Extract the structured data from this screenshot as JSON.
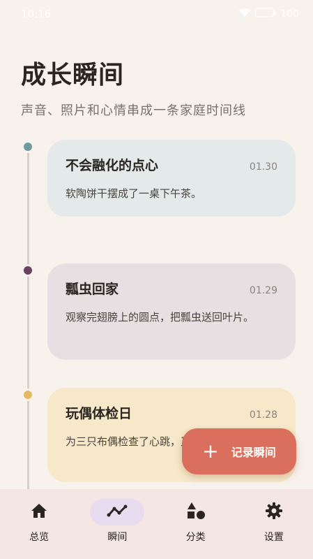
{
  "status_bar": {
    "time": "10:16",
    "battery": "100"
  },
  "header": {
    "title": "成长瞬间",
    "subtitle": "声音、照片和心情串成一条家庭时间线"
  },
  "moments": [
    {
      "title": "不会融化的点心",
      "date": "01.30",
      "text": "软陶饼干摆成了一桌下午茶。",
      "dot_color": "#6e9aa0",
      "card_color": "#e3eae9"
    },
    {
      "title": "瓢虫回家",
      "date": "01.29",
      "text": "观察完翅膀上的圆点，把瓢虫送回叶片。",
      "dot_color": "#6b4160",
      "card_color": "#e7dfe2"
    },
    {
      "title": "玩偶体检日",
      "date": "01.28",
      "text": "为三只布偶检查了心跳，又给小熊点睡。",
      "dot_color": "#e4b867",
      "card_color": "#f6e8c8"
    }
  ],
  "fab": {
    "icon": "plus-icon",
    "label": "记录瞬间",
    "color": "#d96f5c"
  },
  "nav": {
    "background": "#f3e6e3",
    "active_color": "#e8dcf0",
    "items": [
      {
        "label": "总览",
        "icon": "home-icon"
      },
      {
        "label": "瞬间",
        "icon": "trend-icon",
        "active": true
      },
      {
        "label": "分类",
        "icon": "shapes-icon"
      },
      {
        "label": "设置",
        "icon": "gear-icon"
      }
    ]
  }
}
